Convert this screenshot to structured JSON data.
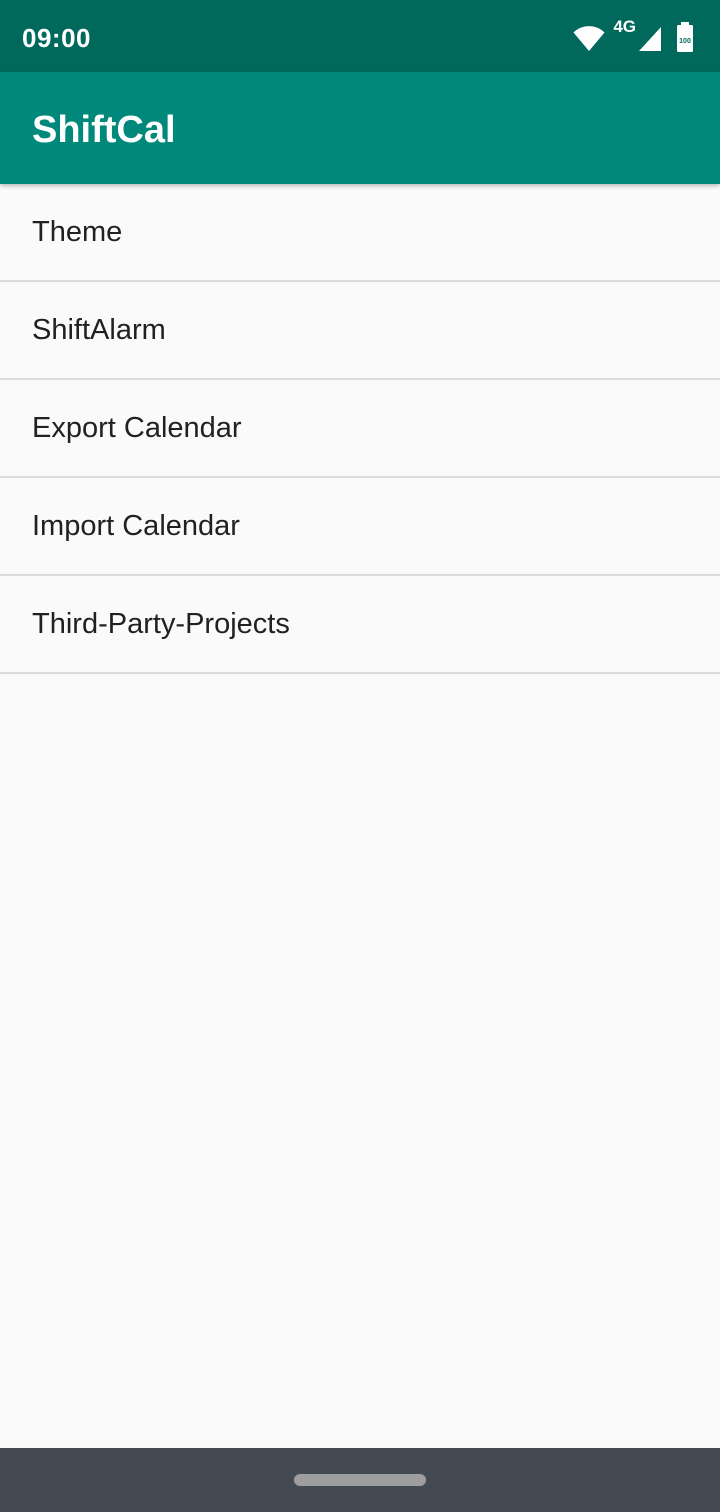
{
  "status_bar": {
    "time": "09:00",
    "network": "4G",
    "battery_level": "100",
    "icons": [
      "wifi-icon",
      "signal-icon",
      "battery-icon"
    ]
  },
  "app_bar": {
    "title": "ShiftCal"
  },
  "settings": {
    "items": [
      {
        "label": "Theme"
      },
      {
        "label": "ShiftAlarm"
      },
      {
        "label": "Export Calendar"
      },
      {
        "label": "Import Calendar"
      },
      {
        "label": "Third-Party-Projects"
      }
    ]
  },
  "colors": {
    "status_bar": "#00695c",
    "app_bar": "#00897b",
    "background": "#fafafa",
    "nav_bar": "#444a52"
  }
}
